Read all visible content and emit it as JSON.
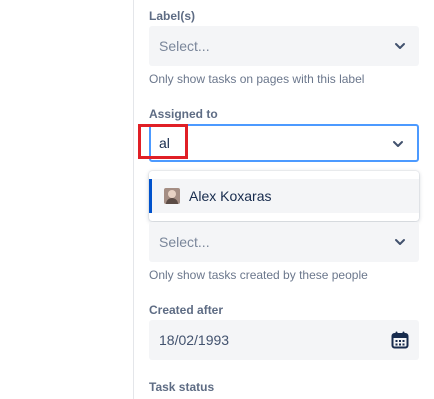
{
  "labels_field": {
    "label": "Label(s)",
    "placeholder": "Select...",
    "help": "Only show tasks on pages with this label"
  },
  "assigned_field": {
    "label": "Assigned to",
    "value": "al",
    "suggestion": {
      "name": "Alex Koxaras",
      "avatar_icon": "user-avatar-icon"
    }
  },
  "created_by_field": {
    "placeholder": "Select...",
    "help": "Only show tasks created by these people"
  },
  "created_after_field": {
    "label": "Created after",
    "value": "18/02/1993",
    "icon": "calendar-icon"
  },
  "task_status_field": {
    "label": "Task status"
  },
  "colors": {
    "focus_border": "#4c9aff",
    "highlight_box": "#e01f26",
    "selected_option_bar": "#0052cc",
    "calendar_icon": "#172b4d"
  }
}
